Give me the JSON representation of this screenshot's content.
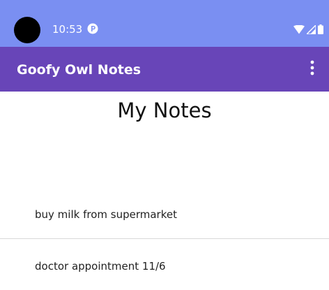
{
  "status_bar": {
    "time": "10:53",
    "icons": [
      "app-notification-icon",
      "wifi-icon",
      "signal-icon",
      "battery-icon"
    ],
    "color": "#7a8ff2"
  },
  "app_bar": {
    "title": "Goofy Owl Notes",
    "overflow_icon": "more-vert-icon",
    "color": "#6845b8"
  },
  "main": {
    "page_title": "My Notes",
    "notes": [
      {
        "text": "buy milk from supermarket"
      },
      {
        "text": "doctor appointment 11/6"
      }
    ]
  }
}
